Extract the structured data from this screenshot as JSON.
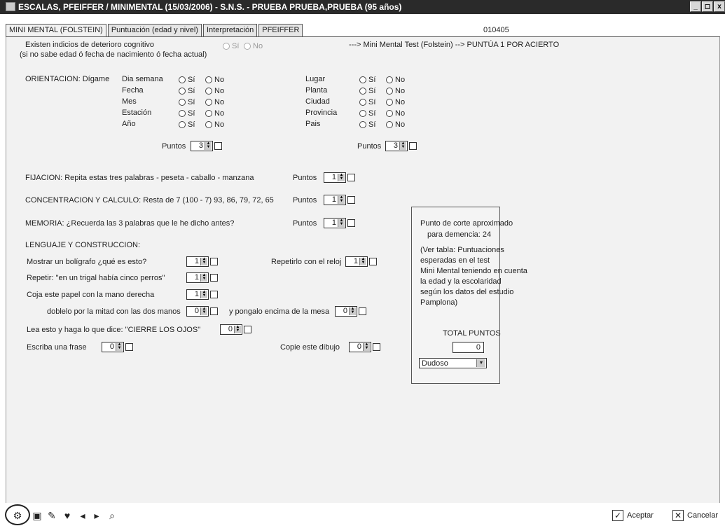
{
  "window": {
    "title": "ESCALAS, PFEIFFER / MINIMENTAL (15/03/2006) - S.N.S. - PRUEBA PRUEBA,PRUEBA (95 años)",
    "min": "_",
    "max": "◻",
    "close": "x"
  },
  "tabs": [
    "MINI MENTAL (FOLSTEIN)",
    "Puntuación (edad y nivel)",
    "Interpretación",
    "PFEIFFER"
  ],
  "record_code": "010405",
  "deterioro": {
    "label": "Existen indicios de deterioro cognitivo",
    "note": "(si no sabe edad ó fecha de nacimiento ó fecha actual)",
    "si": "Sí",
    "no": "No",
    "instruction": "---> Mini Mental Test (Folstein) --> PUNTÚA 1 POR ACIERTO"
  },
  "orientacion": {
    "label": "ORIENTACION: Dígame",
    "left_items": [
      "Dia semana",
      "Fecha",
      "Mes",
      "Estación",
      "Año"
    ],
    "right_items": [
      "Lugar",
      "Planta",
      "Ciudad",
      "Provincia",
      "Pais"
    ],
    "si": "Sí",
    "no": "No",
    "puntos_label": "Puntos",
    "puntos_left": "3",
    "puntos_right": "3"
  },
  "fijacion": {
    "label": "FIJACION: Repita estas tres palabras - peseta - caballo - manzana",
    "puntos_label": "Puntos",
    "value": "1"
  },
  "concentracion": {
    "label": "CONCENTRACION Y CALCULO: Resta de 7 (100 - 7) 93, 86, 79, 72, 65",
    "puntos_label": "Puntos",
    "value": "1"
  },
  "memoria": {
    "label": "MEMORIA: ¿Recuerda las 3 palabras que le he dicho antes?",
    "puntos_label": "Puntos",
    "value": "1"
  },
  "lenguaje": {
    "title": "LENGUAJE Y CONSTRUCCION:",
    "boligrafo": {
      "label": "Mostrar un bolígrafo ¿qué es esto?",
      "value": "1"
    },
    "reloj": {
      "label": "Repetirlo con el reloj",
      "value": "1"
    },
    "repetir": {
      "label": "Repetir: \"en un trigal había cinco perros\"",
      "value": "1"
    },
    "papel": {
      "label": "Coja este papel con la mano derecha",
      "value": "1"
    },
    "doblelo": {
      "label": "doblelo por la mitad con las dos manos",
      "value": "0"
    },
    "encima": {
      "label": "y pongalo encima de la mesa",
      "value": "0"
    },
    "lea": {
      "label": "Lea esto y haga lo que dice: \"CIERRE LOS OJOS\"",
      "value": "0"
    },
    "frase": {
      "label": "Escriba una frase",
      "value": "0"
    },
    "dibujo": {
      "label": "Copie este dibujo",
      "value": "0"
    }
  },
  "info": {
    "corte_1": "Punto de corte aproximado",
    "corte_2": "para demencia: 24",
    "ver_1": "(Ver tabla: Puntuaciones",
    "ver_2": "esperadas en el test",
    "ver_3": "Mini Mental teniendo en cuenta",
    "ver_4": "la edad y la escolaridad",
    "ver_5": "según los datos del estudio",
    "ver_6": "Pamplona)",
    "total_label": "TOTAL PUNTOS",
    "total_value": "0",
    "select_value": "Dudoso"
  },
  "footer": {
    "aceptar": "Aceptar",
    "cancelar": "Cancelar"
  },
  "icons": [
    "settings-icon",
    "save-icon",
    "edit-icon",
    "heart-icon",
    "prev-icon",
    "next-icon",
    "search-icon"
  ]
}
